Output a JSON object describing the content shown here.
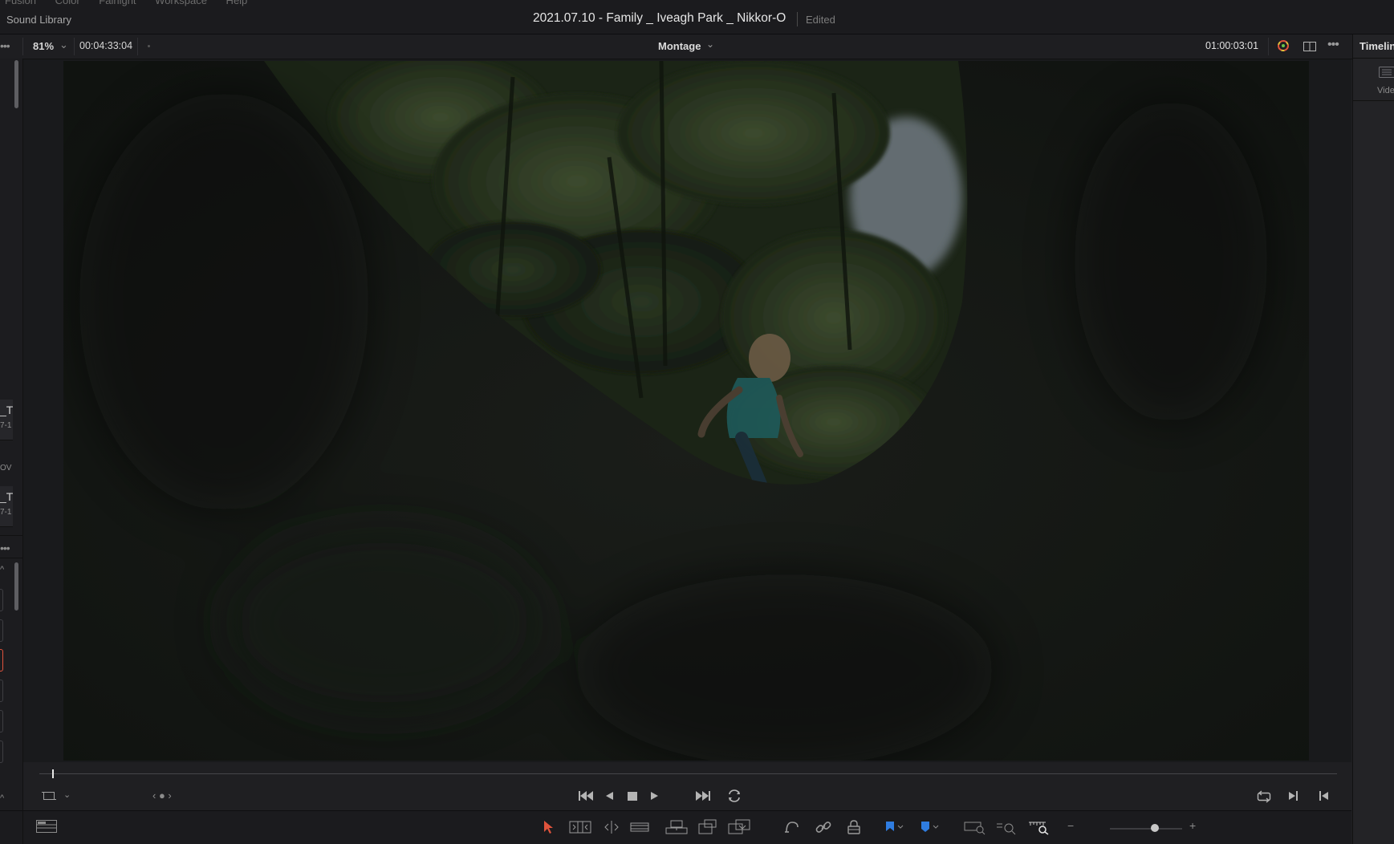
{
  "menu": {
    "ghost_items": "Fusion Color Fairlight Workspace Help"
  },
  "titlebar": {
    "left_label": "Sound Library",
    "project_title": "2021.07.10 - Family _ Iveagh Park _ Nikkor-O",
    "status": "Edited"
  },
  "viewer": {
    "zoom": "81%",
    "source_timecode": "00:04:33:04",
    "timeline_name": "Montage",
    "record_timecode": "01:00:03:01",
    "playhead_position_fraction": 0.01
  },
  "right_panel": {
    "tab_label": "Timelin",
    "sub_label": "Vide"
  },
  "left_strip": {
    "clip_a_title": "_T",
    "clip_a_sub": "7-1",
    "mid_label": "OV",
    "clip_b_title": "_T",
    "clip_b_sub": "7-1"
  },
  "icons": {
    "transport": [
      "skip-to-start-icon",
      "play-reverse-icon",
      "stop-icon",
      "play-icon",
      "skip-to-end-icon",
      "loop-icon"
    ],
    "toolbar": [
      "selection-arrow-icon",
      "trim-edit-icon",
      "dynamic-trim-icon",
      "blade-icon",
      "insert-clip-icon",
      "overwrite-clip-icon",
      "replace-clip-icon",
      "snapping-icon",
      "linked-selection-icon",
      "position-lock-icon",
      "flag-icon",
      "marker-icon",
      "zoom-full-icon",
      "zoom-detail-icon",
      "zoom-custom-icon"
    ]
  },
  "colors": {
    "accent_red": "#e0533c",
    "flag_blue": "#2f7de1",
    "panel_bg": "#1f1f22"
  }
}
